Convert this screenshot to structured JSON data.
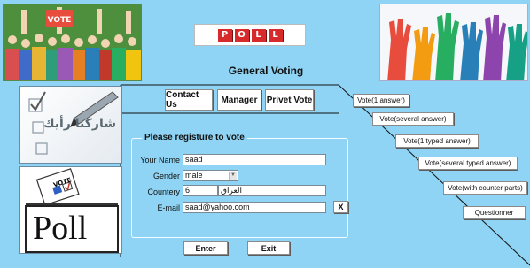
{
  "header": {
    "title": "General Voting",
    "logo_letters": [
      "P",
      "O",
      "L",
      "L"
    ]
  },
  "left": {
    "share_text": "شاركنا رأيك",
    "vote_box_label": "VOTE",
    "poll_word": "Poll"
  },
  "nav": {
    "contact_label": "Contact Us",
    "manager_label": "Manager",
    "privet_label": "Privet Vote"
  },
  "form": {
    "legend": "Please registure to vote",
    "name_label": "Your Name",
    "name_value": "saad",
    "gender_label": "Gender",
    "gender_value": "male",
    "country_label": "Countery",
    "country_code": "6",
    "country_name": "العراق",
    "email_label": "E-mail",
    "email_value": "saad@yahoo.com",
    "clear_label": "X",
    "enter_label": "Enter",
    "exit_label": "Exit"
  },
  "vote_menu": [
    "Vote(1 answer)",
    "Vote(several answer)",
    "Vote(1 typed answer)",
    "Vote(several typed answer)",
    "Vote(with counter parts)",
    "Questionner"
  ],
  "colors": {
    "background": "#8fd4f4",
    "logo_red": "#d72a2a"
  }
}
